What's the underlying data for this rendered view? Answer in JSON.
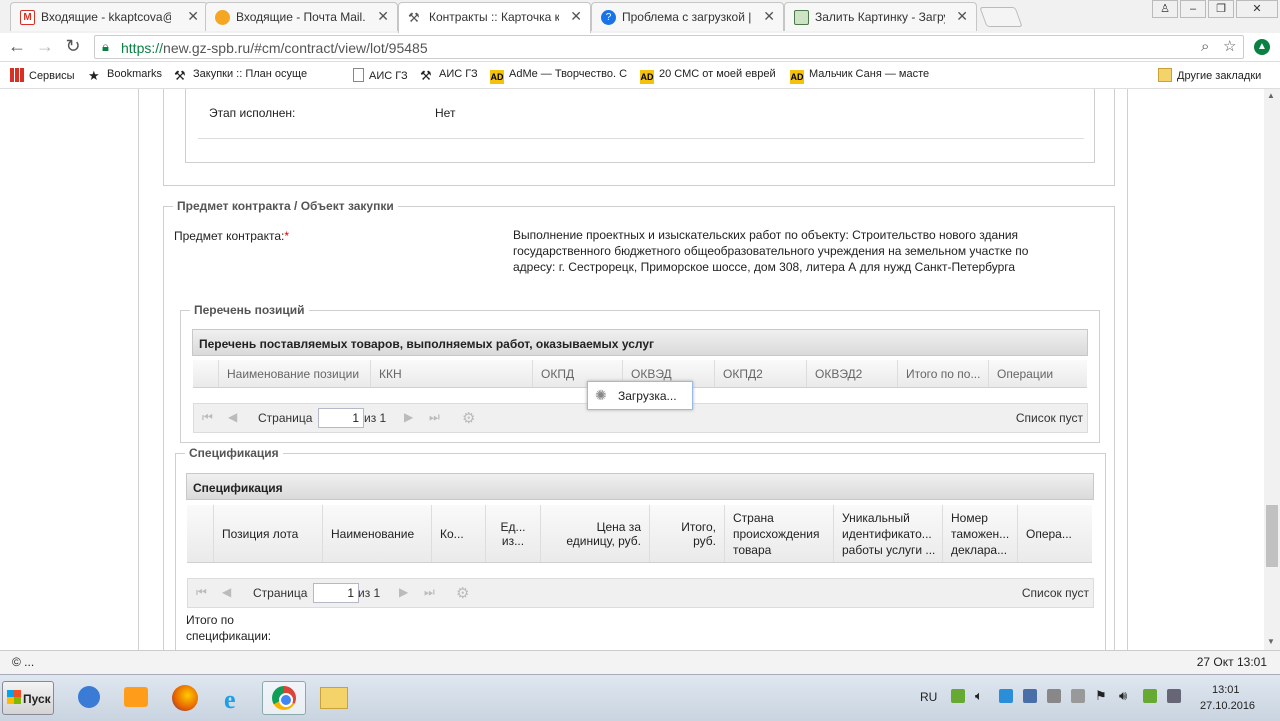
{
  "tabs": [
    {
      "title": "Входящие - kkaptcova@gm",
      "icon": "gmail-icon",
      "color": "#d93025"
    },
    {
      "title": "Входящие - Почта Mail.Ru",
      "icon": "mailru-icon",
      "color": "#1a73e8"
    },
    {
      "title": "Контракты :: Карточка ко",
      "icon": "tools-icon",
      "color": "#555555"
    },
    {
      "title": "Проблема с загрузкой | Н",
      "icon": "question-icon",
      "color": "#1a73e8"
    },
    {
      "title": "Залить Картинку - Загрузк",
      "icon": "image-icon",
      "color": "#4a7a4a"
    }
  ],
  "address": {
    "scheme": "https://",
    "rest": "new.gz-spb.ru/#cm/contract/view/lot/95485"
  },
  "bookmarks": [
    {
      "label": "Сервисы",
      "icon": "apps-icon"
    },
    {
      "label": "Bookmarks",
      "icon": "star-icon"
    },
    {
      "label": "Закупки :: План осуще",
      "icon": "tools-icon"
    },
    {
      "label": "АИС ГЗ",
      "icon": "page-icon"
    },
    {
      "label": "АИС ГЗ",
      "icon": "tools-icon"
    },
    {
      "label": "AdMe — Творчество. С",
      "icon": "ad-icon"
    },
    {
      "label": "20 СМС от моей еврей",
      "icon": "ad-icon"
    },
    {
      "label": "Мальчик Саня — масте",
      "icon": "ad-icon"
    }
  ],
  "bookmarks_other": "Другие закладки",
  "ad_badge": "AD",
  "stage": {
    "label": "Этап исполнен:",
    "value": "Нет"
  },
  "subject_section": {
    "legend": "Предмет контракта / Объект закупки",
    "label": "Предмет контракта:",
    "required_mark": "*",
    "text_lines": [
      "Выполнение проектных и изыскательских работ по объекту: Строительство нового здания",
      "государственного бюджетного общеобразовательного учреждения на земельном участке по",
      "адресу: г. Сестрорецк, Приморское шоссе, дом 308, литера А для нужд Санкт-Петербурга"
    ]
  },
  "positions": {
    "legend": "Перечень позиций",
    "grid_title": "Перечень поставляемых товаров, выполняемых работ, оказываемых услуг",
    "columns": [
      "Наименование позиции",
      "ККН",
      "ОКПД",
      "ОКВЭД",
      "ОКПД2",
      "ОКВЭД2",
      "Итого по по...",
      "Операции"
    ],
    "loading": "Загрузка...",
    "pager": {
      "page_label": "Страница",
      "page": "1",
      "of": "из 1",
      "empty": "Список пуст"
    }
  },
  "spec": {
    "legend": "Спецификация",
    "grid_title": "Спецификация",
    "columns": [
      [
        "Позиция лота"
      ],
      [
        "Наименование"
      ],
      [
        "Ко..."
      ],
      [
        "Ед...",
        "из..."
      ],
      [
        "Цена за",
        "единицу, руб."
      ],
      [
        "Итого,",
        "руб."
      ],
      [
        "Страна",
        "происхождения",
        "товара"
      ],
      [
        "Уникальный",
        "идентификато...",
        "работы услуги ..."
      ],
      [
        "Номер",
        "таможен...",
        "деклара..."
      ],
      [
        "Опера..."
      ]
    ],
    "pager": {
      "page_label": "Страница",
      "page": "1",
      "of": "из 1",
      "empty": "Список пуст"
    },
    "total_lines": [
      "Итого по",
      "спецификации:"
    ]
  },
  "status": {
    "left": "© ...",
    "right": "27 Окт 13:01"
  },
  "taskbar": {
    "start": "Пуск",
    "lang": "RU",
    "time": "13:01",
    "date": "27.10.2016"
  }
}
